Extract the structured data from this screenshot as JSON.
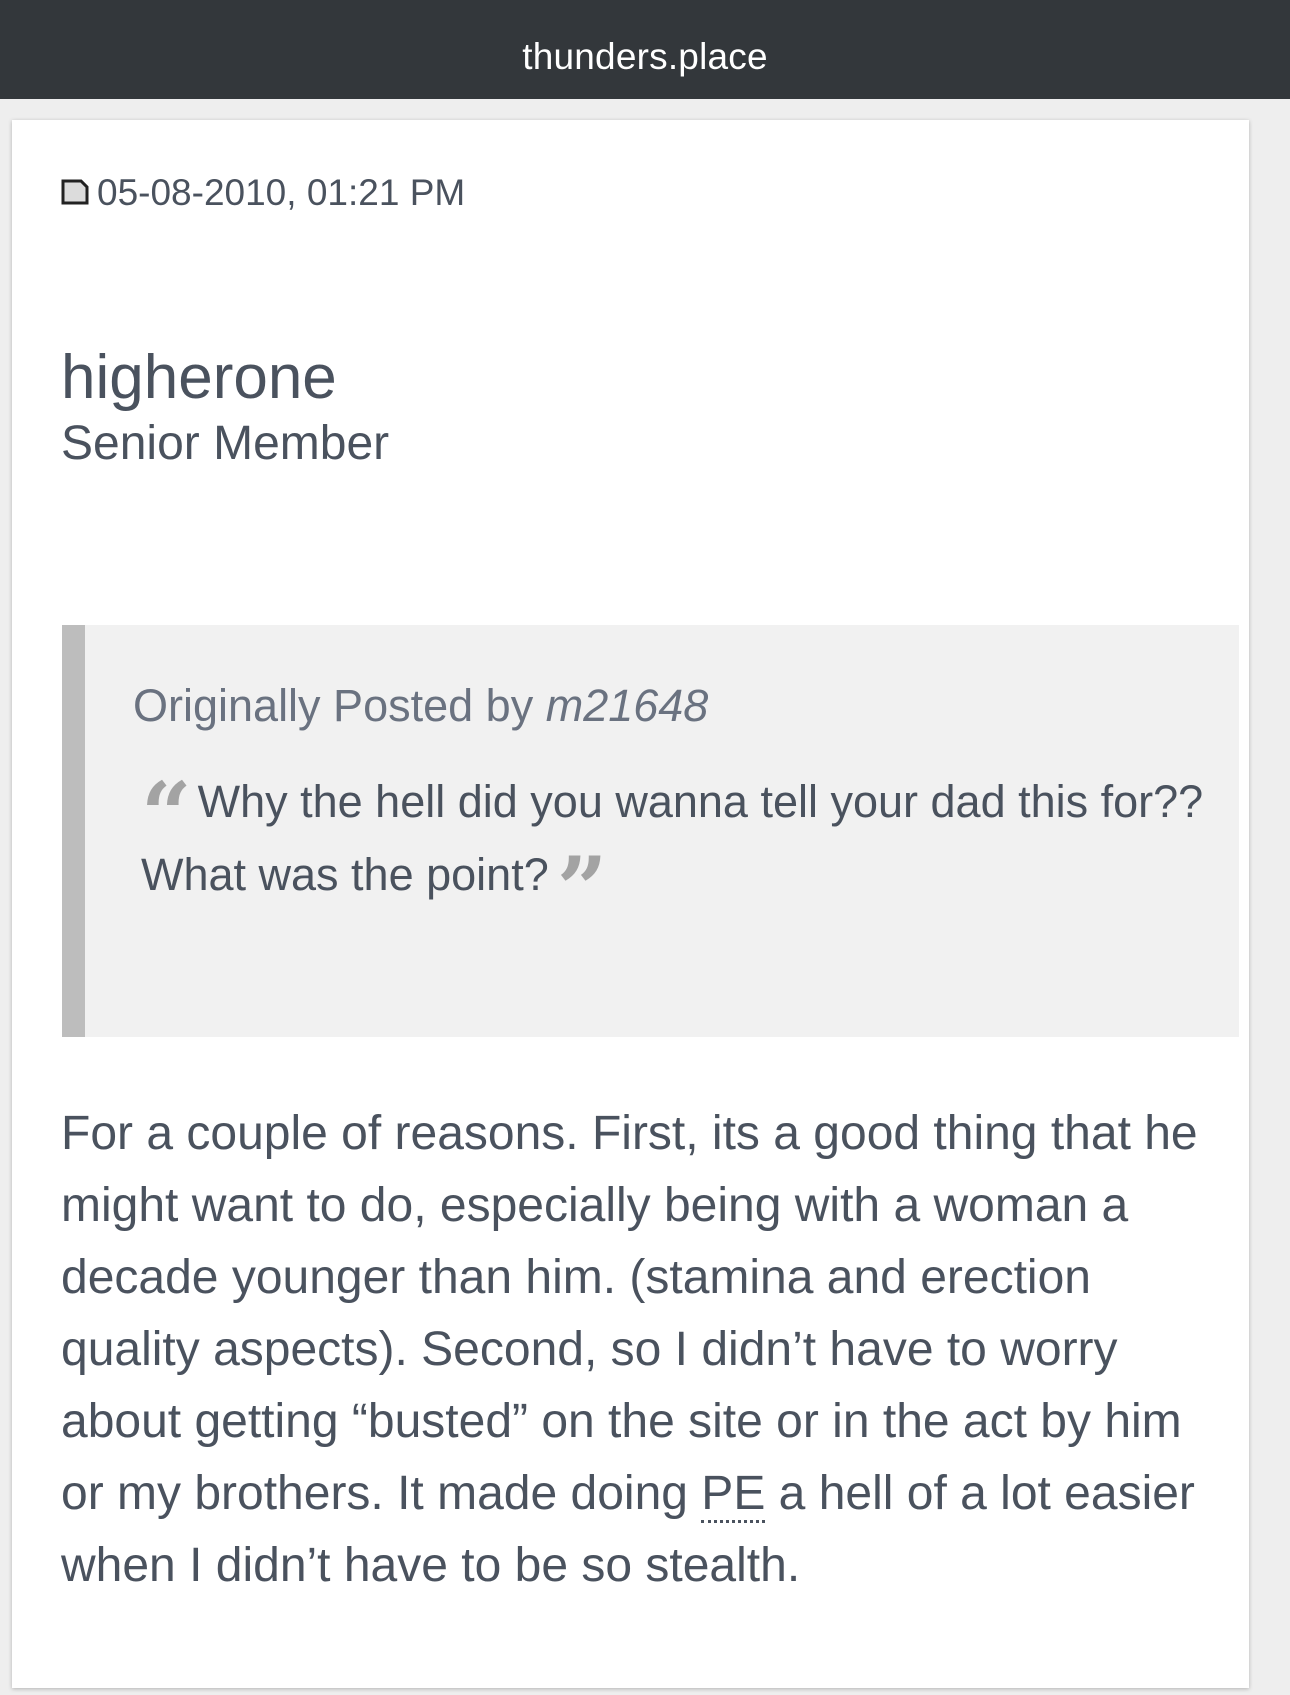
{
  "header": {
    "site_title": "thunders.place"
  },
  "post": {
    "datetime": "05-08-2010, 01:21 PM",
    "username": "higherone",
    "user_title": "Senior Member",
    "quote": {
      "attribution_prefix": "Originally Posted by",
      "author": "m21648",
      "text": "Why the hell did you wanna tell your dad this for?? What was the point?",
      "open_mark": "“",
      "close_mark": "”"
    },
    "body_before_abbr": "For a couple of reasons. First, its a good thing that he might want to do, especially being with a woman a decade younger than him. (stamina and erection quality aspects). Second, so I didn’t have to worry about getting “busted” on the site or in the act by him or my brothers. It made doing ",
    "body_abbr": "PE",
    "body_after_abbr": " a hell of a lot easier when I didn’t have to be so stealth."
  },
  "icons": {
    "post_icon": "post-page-icon"
  },
  "colors": {
    "topbar_bg": "#33373b",
    "text": "#4a525e",
    "quote_bg": "#f1f1f1",
    "quote_border": "#bdbdbd"
  }
}
